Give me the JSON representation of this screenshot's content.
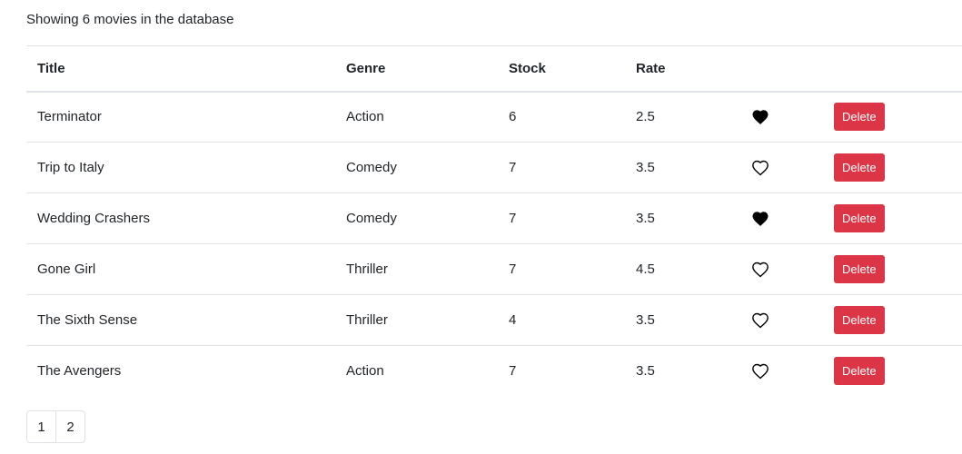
{
  "summary": "Showing 6 movies in the database",
  "columns": {
    "title": "Title",
    "genre": "Genre",
    "stock": "Stock",
    "rate": "Rate"
  },
  "movies": [
    {
      "title": "Terminator",
      "genre": "Action",
      "stock": "6",
      "rate": "2.5",
      "liked": true,
      "delete_label": "Delete"
    },
    {
      "title": "Trip to Italy",
      "genre": "Comedy",
      "stock": "7",
      "rate": "3.5",
      "liked": false,
      "delete_label": "Delete"
    },
    {
      "title": "Wedding Crashers",
      "genre": "Comedy",
      "stock": "7",
      "rate": "3.5",
      "liked": true,
      "delete_label": "Delete"
    },
    {
      "title": "Gone Girl",
      "genre": "Thriller",
      "stock": "7",
      "rate": "4.5",
      "liked": false,
      "delete_label": "Delete"
    },
    {
      "title": "The Sixth Sense",
      "genre": "Thriller",
      "stock": "4",
      "rate": "3.5",
      "liked": false,
      "delete_label": "Delete"
    },
    {
      "title": "The Avengers",
      "genre": "Action",
      "stock": "7",
      "rate": "3.5",
      "liked": false,
      "delete_label": "Delete"
    }
  ],
  "pagination": {
    "pages": [
      "1",
      "2"
    ]
  },
  "colors": {
    "delete": "#dc3545",
    "heart": "#000000",
    "border": "#dee2e6",
    "text": "#212529"
  },
  "icons": {
    "liked": "heart-filled-icon",
    "unliked": "heart-outline-icon"
  }
}
